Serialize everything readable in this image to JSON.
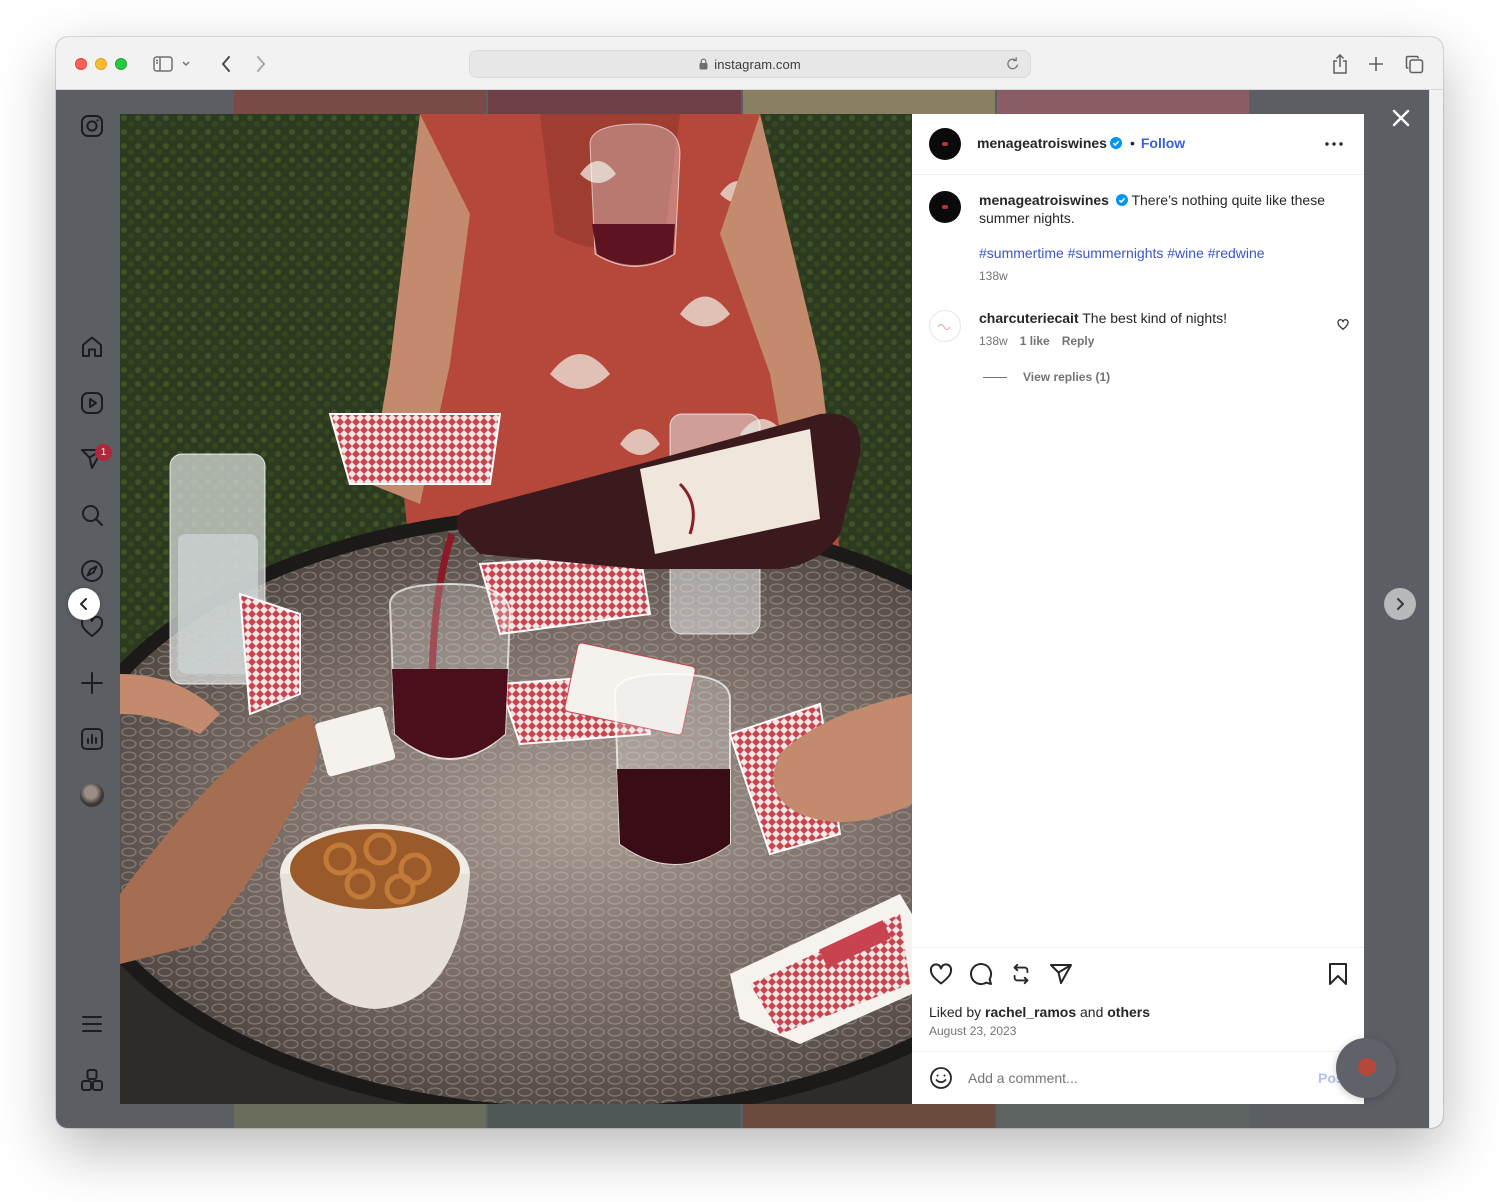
{
  "browser": {
    "url": "instagram.com"
  },
  "nav": {
    "notification_count": "1"
  },
  "post": {
    "username": "menageatroiswines",
    "follow_label": "Follow",
    "caption": "There’s nothing quite like these summer nights.",
    "hashtags": "#summertime #summernights #wine #redwine",
    "caption_age": "138w"
  },
  "comment": {
    "username": "charcuteriecait",
    "text": "The best kind of nights!",
    "age": "138w",
    "likes": "1 like",
    "reply_label": "Reply",
    "view_replies": "View replies (1)"
  },
  "actions": {
    "liked_by_prefix": "Liked by",
    "liked_by_user": "rachel_ramos",
    "liked_by_and": "and",
    "liked_by_others": "others",
    "date": "August 23, 2023"
  },
  "add_comment": {
    "placeholder": "Add a comment...",
    "post_label": "Post"
  },
  "colors": {
    "accent_blue": "#3b5fdc",
    "verified_blue": "#0095f6",
    "badge_red": "#b0263a"
  }
}
